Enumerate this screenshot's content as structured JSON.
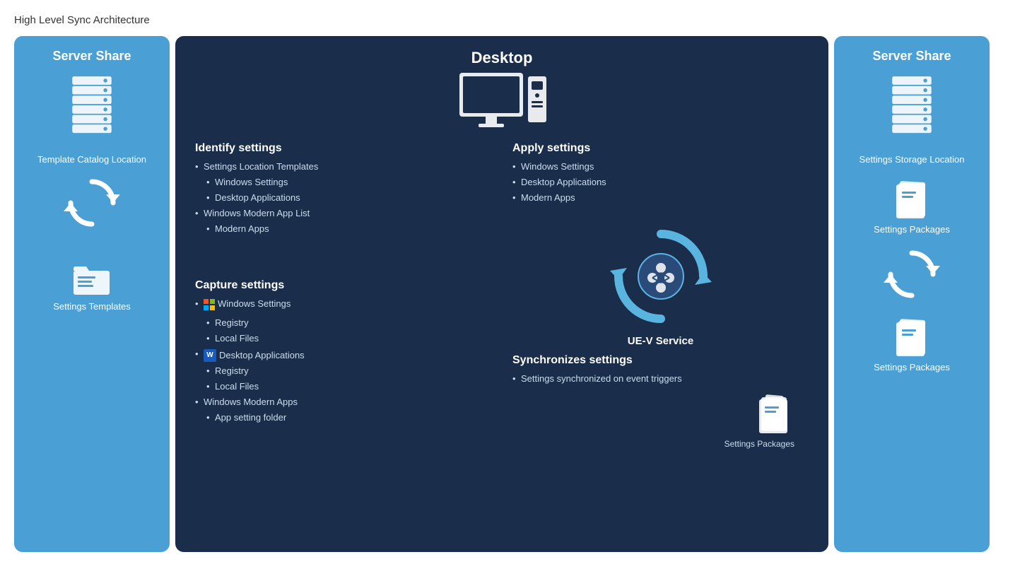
{
  "pageTitle": "High Level Sync Architecture",
  "leftPanel": {
    "title": "Server Share",
    "catalogLabel": "Template Catalog Location",
    "templatesLabel": "Settings Templates"
  },
  "rightPanel": {
    "title": "Server Share",
    "storageLabel": "Settings Storage Location",
    "pkgLabel": "Settings Packages"
  },
  "centerPanel": {
    "title": "Desktop",
    "uevLabel": "UE-V Service",
    "identifyTitle": "Identify settings",
    "identifyItems": [
      {
        "text": "Settings Location Templates",
        "level": 1
      },
      {
        "text": "Windows Settings",
        "level": 2
      },
      {
        "text": "Desktop Applications",
        "level": 2
      },
      {
        "text": "Windows Modern App List",
        "level": 1
      },
      {
        "text": "Modern Apps",
        "level": 2
      }
    ],
    "applyTitle": "Apply settings",
    "applyItems": [
      {
        "text": "Windows Settings",
        "level": 1
      },
      {
        "text": "Desktop Applications",
        "level": 1
      },
      {
        "text": "Modern Apps",
        "level": 1
      }
    ],
    "captureTitle": "Capture settings",
    "captureItems": [
      {
        "text": "Windows Settings",
        "level": 1,
        "icon": "windows"
      },
      {
        "text": "Registry",
        "level": 2
      },
      {
        "text": "Local Files",
        "level": 2
      },
      {
        "text": "Desktop Applications",
        "level": 1,
        "icon": "word"
      },
      {
        "text": "Registry",
        "level": 2
      },
      {
        "text": "Local Files",
        "level": 2
      },
      {
        "text": "Windows Modern Apps",
        "level": 1
      },
      {
        "text": "App setting folder",
        "level": 2
      }
    ],
    "syncTitle": "Synchronizes settings",
    "syncItems": [
      {
        "text": "Settings synchronized on event triggers",
        "level": 1
      }
    ],
    "settingsPkgLabel": "Settings Packages"
  }
}
